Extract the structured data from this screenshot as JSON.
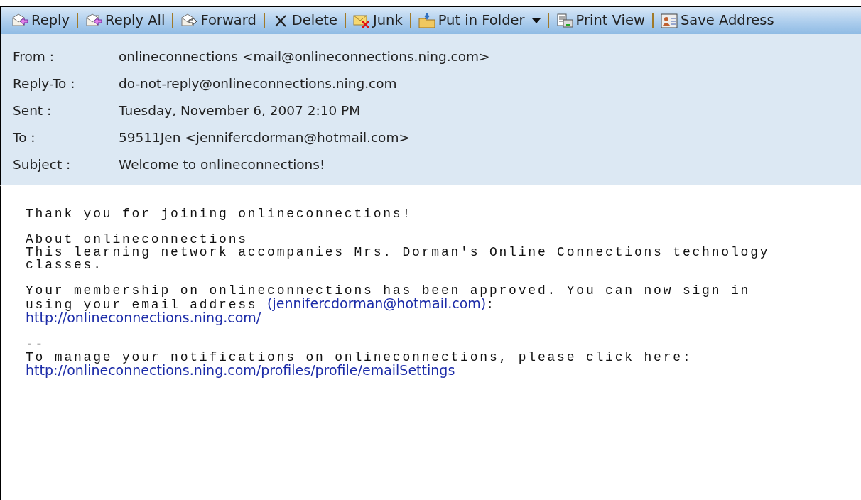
{
  "toolbar": [
    {
      "kind": "reply",
      "label": "Reply"
    },
    {
      "kind": "reply_all",
      "label": "Reply All"
    },
    {
      "kind": "forward",
      "label": "Forward"
    },
    {
      "kind": "delete",
      "label": "Delete"
    },
    {
      "kind": "junk",
      "label": "Junk"
    },
    {
      "kind": "folder",
      "label": "Put in Folder",
      "dropdown": true
    },
    {
      "kind": "print",
      "label": "Print View"
    },
    {
      "kind": "contact",
      "label": "Save Address"
    }
  ],
  "headers": [
    {
      "label": "From :",
      "value": "onlineconnections <mail@onlineconnections.ning.com>"
    },
    {
      "label": "Reply-To :",
      "value": "do-not-reply@onlineconnections.ning.com"
    },
    {
      "label": "Sent :",
      "value": "Tuesday, November 6, 2007 2:10 PM"
    },
    {
      "label": "To :",
      "value": "59511Jen <jennifercdorman@hotmail.com>"
    },
    {
      "label": "Subject :",
      "value": "Welcome to onlineconnections!"
    }
  ],
  "body": [
    [
      [
        {
          "kind": "text",
          "text": "Thank you for joining onlineconnections!"
        }
      ]
    ],
    [
      [
        {
          "kind": "text",
          "text": "About onlineconnections"
        }
      ],
      [
        {
          "kind": "text",
          "text": "This learning network accompanies Mrs. Dorman's Online Connections technology"
        }
      ],
      [
        {
          "kind": "text",
          "text": "classes."
        }
      ]
    ],
    [
      [
        {
          "kind": "text",
          "text": "Your membership on onlineconnections has been approved. You can now sign in"
        }
      ],
      [
        {
          "kind": "text",
          "text": "using your email address "
        },
        {
          "kind": "link",
          "text": "(jennifercdorman@hotmail.com)"
        },
        {
          "kind": "text",
          "text": ":"
        }
      ],
      [
        {
          "kind": "link",
          "text": "http://onlineconnections.ning.com/"
        }
      ]
    ],
    [
      [
        {
          "kind": "text",
          "text": "--"
        }
      ],
      [
        {
          "kind": "text",
          "text": "To manage your notifications on onlineconnections, please click here:"
        }
      ],
      [
        {
          "kind": "link",
          "text": "http://onlineconnections.ning.com/profiles/profile/emailSettings"
        }
      ]
    ]
  ]
}
